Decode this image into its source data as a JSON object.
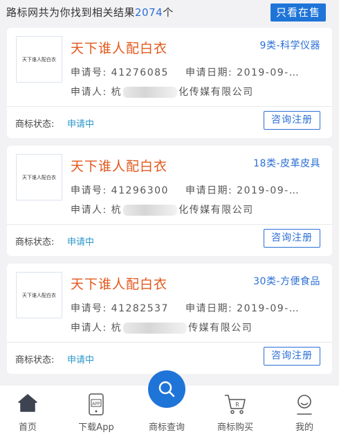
{
  "header": {
    "result_prefix": "路标网共为你找到相关结果",
    "result_count": "2074",
    "result_suffix": "个",
    "only_selling_button": "只看在售"
  },
  "cards": [
    {
      "logo_text": "天下谁人配白衣",
      "name": "天下谁人配白衣",
      "class": "9类-科学仪器",
      "app_no_label": "申请号:",
      "app_no": "41276085",
      "date_label": "申请日期:",
      "date": "2019-09-…",
      "applicant_label": "申请人:",
      "applicant_start": "杭",
      "applicant_end": "化传媒有限公司",
      "status_label": "商标状态:",
      "status": "申请中",
      "consult_button": "咨询注册"
    },
    {
      "logo_text": "天下谁人配白衣",
      "name": "天下谁人配白衣",
      "class": "18类-皮革皮具",
      "app_no_label": "申请号:",
      "app_no": "41296300",
      "date_label": "申请日期:",
      "date": "2019-09-…",
      "applicant_label": "申请人:",
      "applicant_start": "杭",
      "applicant_end": "化传媒有限公司",
      "status_label": "商标状态:",
      "status": "申请中",
      "consult_button": "咨询注册"
    },
    {
      "logo_text": "天下谁人配白衣",
      "name": "天下谁人配白衣",
      "class": "30类-方便食品",
      "app_no_label": "申请号:",
      "app_no": "41282537",
      "date_label": "申请日期:",
      "date": "2019-09-…",
      "applicant_label": "申请人:",
      "applicant_start": "杭",
      "applicant_end": "传媒有限公司",
      "status_label": "商标状态:",
      "status": "申请中",
      "consult_button": "咨询注册"
    }
  ],
  "nav": {
    "items": [
      {
        "label": "首页",
        "icon": "home-icon"
      },
      {
        "label": "下载App",
        "icon": "phone-app-icon"
      },
      {
        "label": "商标查询",
        "icon": "search-icon"
      },
      {
        "label": "商标购买",
        "icon": "cart-icon"
      },
      {
        "label": "我的",
        "icon": "user-icon"
      }
    ]
  },
  "colors": {
    "accent_blue": "#1f74d8",
    "trademark_orange": "#e2581c",
    "status_cyan": "#2a97c9",
    "background": "#f2f2f4"
  }
}
